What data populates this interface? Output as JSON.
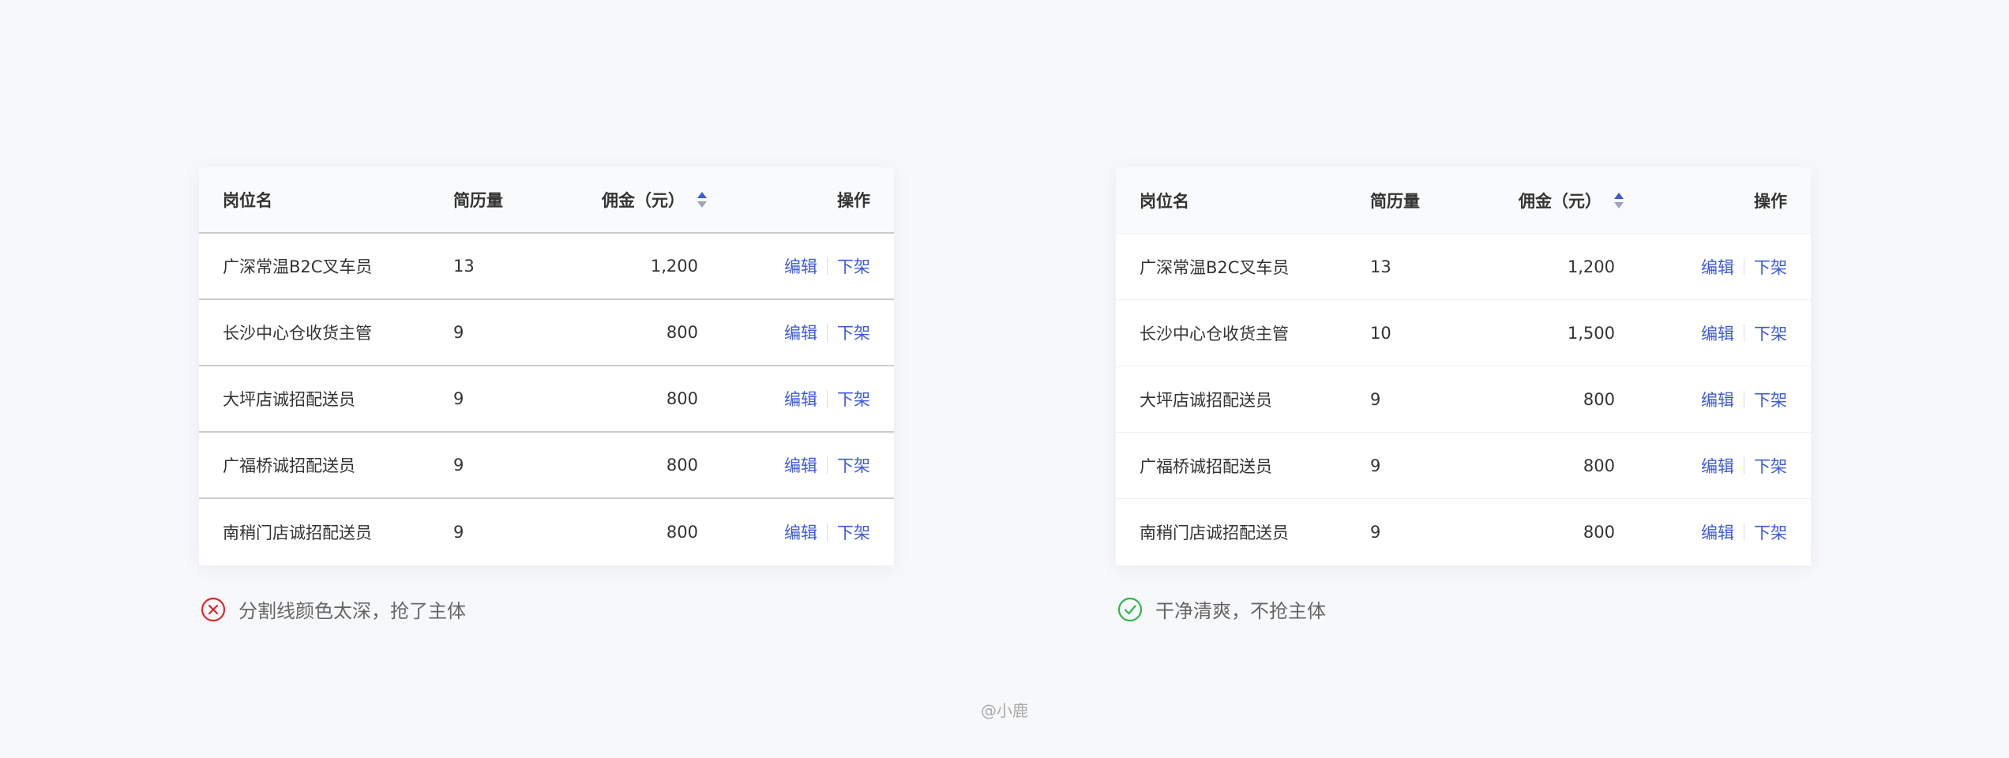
{
  "table_headers": {
    "name": "岗位名",
    "count": "简历量",
    "fee": "佣金（元）",
    "action": "操作"
  },
  "actions": {
    "edit": "编辑",
    "offline": "下架"
  },
  "bad_example": {
    "rows": [
      {
        "name": "广深常温B2C叉车员",
        "count": "13",
        "fee": "1,200"
      },
      {
        "name": "长沙中心仓收货主管",
        "count": "9",
        "fee": "800"
      },
      {
        "name": "大坪店诚招配送员",
        "count": "9",
        "fee": "800"
      },
      {
        "name": "广福桥诚招配送员",
        "count": "9",
        "fee": "800"
      },
      {
        "name": "南稍门店诚招配送员",
        "count": "9",
        "fee": "800"
      }
    ],
    "caption": "分割线颜色太深，抢了主体",
    "caption_icon": "error-x-circle-icon",
    "caption_icon_color": "#e0282e"
  },
  "good_example": {
    "rows": [
      {
        "name": "广深常温B2C叉车员",
        "count": "13",
        "fee": "1,200"
      },
      {
        "name": "长沙中心仓收货主管",
        "count": "10",
        "fee": "1,500"
      },
      {
        "name": "大坪店诚招配送员",
        "count": "9",
        "fee": "800"
      },
      {
        "name": "广福桥诚招配送员",
        "count": "9",
        "fee": "800"
      },
      {
        "name": "南稍门店诚招配送员",
        "count": "9",
        "fee": "800"
      }
    ],
    "caption": "干净清爽，不抢主体",
    "caption_icon": "check-circle-icon",
    "caption_icon_color": "#2fb84f"
  },
  "colors": {
    "link": "#3c5bd9",
    "heavy_separator": "#cccccc",
    "light_separator": "#f0f1f3",
    "sort_active": "#3c5bd9",
    "sort_inactive": "#9aa3b8"
  },
  "credit": "@小鹿"
}
